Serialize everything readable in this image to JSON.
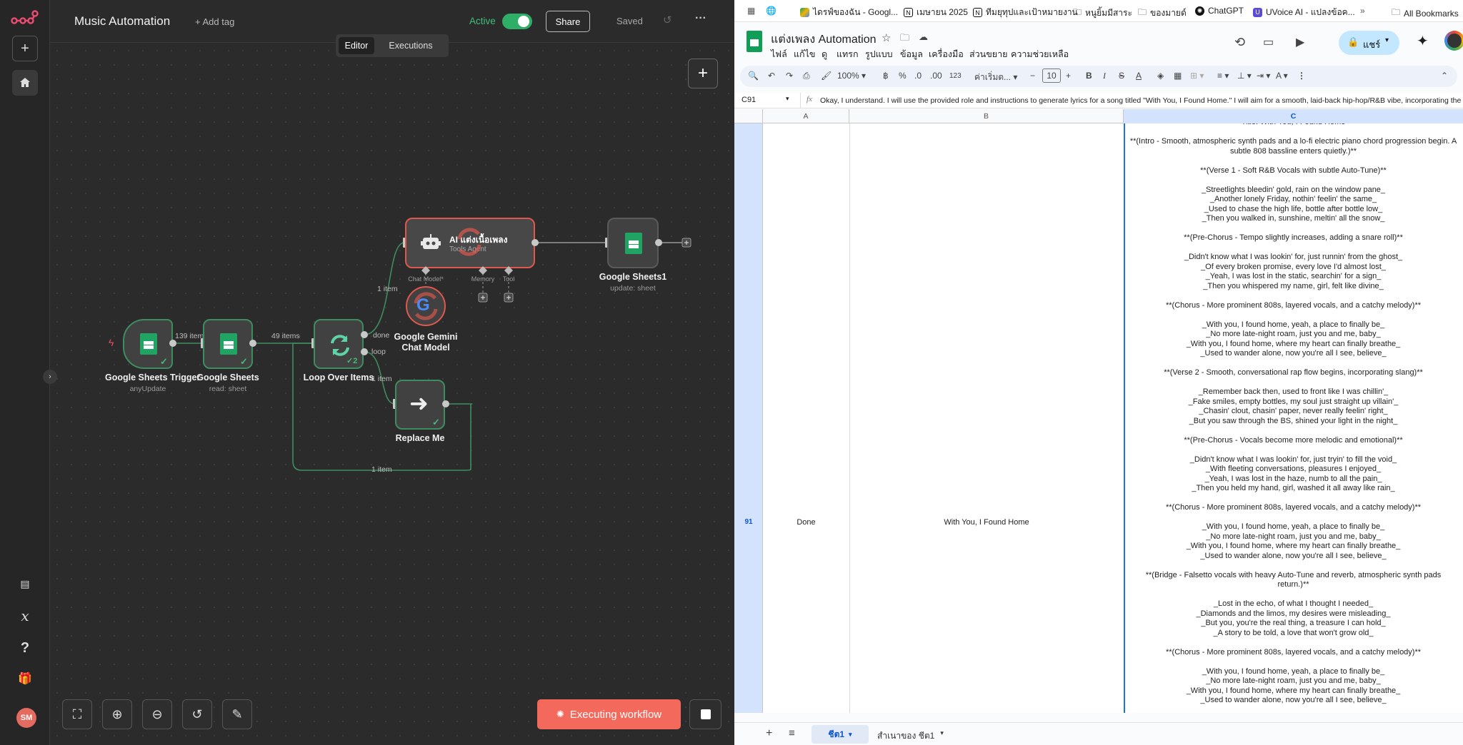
{
  "n8n": {
    "workflow_name": "Music Automation",
    "add_tag": "+ Add tag",
    "active_label": "Active",
    "share_label": "Share",
    "saved_label": "Saved",
    "tabs": {
      "editor": "Editor",
      "executions": "Executions"
    },
    "avatar_initials": "SM",
    "execute_label": "Executing workflow",
    "nodes": {
      "trigger": {
        "title": "Google Sheets Trigger",
        "sub": "anyUpdate"
      },
      "sheets": {
        "title": "Google Sheets",
        "sub": "read: sheet"
      },
      "loop": {
        "title": "Loop Over Items",
        "badge": "2"
      },
      "ai": {
        "title": "AI แต่งเนื้อเพลง",
        "sub": "Tools Agent",
        "slots": [
          "Chat Model*",
          "Memory",
          "Tool"
        ]
      },
      "gemini": {
        "title": "Google Gemini Chat Model"
      },
      "sheets1": {
        "title": "Google Sheets1",
        "sub": "update: sheet"
      },
      "replace": {
        "title": "Replace Me"
      }
    },
    "edges": {
      "e1": "139 items",
      "e2": "49 items",
      "e3": "1 item",
      "done": "done",
      "loop": "loop",
      "e4": "1 item",
      "e5": "1 item"
    }
  },
  "sheets": {
    "bookmarks": [
      "ไดรฟ์ของฉัน - Googl...",
      "เมษายน 2025",
      "ทีมยุทุปและเป้าหมายงาน",
      "หนูยิ้มมีสาระ",
      "ของมายด์",
      "ChatGPT",
      "UVoice AI - แปลงข้อค...",
      "All Bookmarks"
    ],
    "doc_title": "แต่งเพลง Automation",
    "menu": [
      "ไฟล์",
      "แก้ไข",
      "ดู",
      "แทรก",
      "รูปแบบ",
      "ข้อมูล",
      "เครื่องมือ",
      "ส่วนขยาย",
      "ความช่วยเหลือ"
    ],
    "share_label": "แชร์",
    "toolbar": {
      "zoom": "100%",
      "currency": "฿",
      "percent": "%",
      "dec1": ".0",
      "dec2": ".00",
      "num": "123",
      "font": "ค่าเริ่มต...",
      "size": "10"
    },
    "cell_ref": "C91",
    "formula": "Okay, I understand. I will use the provided role and instructions to generate lyrics for a song titled \"With You, I Found Home.\" I will aim for a smooth, laid-back hip-hop/R&B vibe, incorporating the",
    "columns": [
      "A",
      "B",
      "C"
    ],
    "row_number": "91",
    "cell_a": "Done",
    "cell_b": "With You, I Found Home",
    "lyrics": [
      "Title: With You, I Found Home",
      "",
      "**(Intro - Smooth, atmospheric synth pads and a lo-fi electric piano chord progression begin.  A",
      "subtle 808 bassline enters quietly.)**",
      "",
      "**(Verse 1 - Soft R&B Vocals with subtle Auto-Tune)**",
      "",
      "_Streetlights bleedin' gold, rain on the window pane_",
      "_Another lonely Friday, nothin' feelin' the same_",
      "_Used to chase the high life, bottle after bottle low_",
      "_Then you walked in, sunshine, meltin' all the snow_",
      "",
      "**(Pre-Chorus - Tempo slightly increases, adding a snare roll)**",
      "",
      "_Didn't know what I was lookin' for, just runnin' from the ghost_",
      "_Of every broken promise, every love I'd almost lost_",
      "_Yeah, I was lost in the static, searchin' for a sign_",
      "_Then you whispered my name, girl, felt like divine_",
      "",
      "**(Chorus - More prominent 808s, layered vocals, and a catchy melody)**",
      "",
      "_With you, I found home, yeah, a place to finally be_",
      "_No more late-night roam, just you and me, baby_",
      "_With you, I found home, where my heart can finally breathe_",
      "_Used to wander alone, now you're all I see, believe_",
      "",
      "**(Verse 2 -  Smooth, conversational rap flow begins, incorporating slang)**",
      "",
      "_Remember back then, used to front like I was chillin'_",
      "_Fake smiles, empty bottles, my soul just straight up villain'_",
      "_Chasin' clout, chasin' paper, never really feelin' right_",
      "_But you saw through the BS, shined your light in the night_",
      "",
      "**(Pre-Chorus - Vocals become more melodic and emotional)**",
      "",
      "_Didn't know what I was lookin' for, just tryin' to fill the void_",
      "_With fleeting conversations, pleasures I enjoyed_",
      "_Yeah, I was lost in the haze, numb to all the pain_",
      "_Then you held my hand, girl, washed it all away like rain_",
      "",
      "**(Chorus - More prominent 808s, layered vocals, and a catchy melody)**",
      "",
      "_With you, I found home, yeah, a place to finally be_",
      "_No more late-night roam, just you and me, baby_",
      "_With you, I found home, where my heart can finally breathe_",
      "_Used to wander alone, now you're all I see, believe_",
      "",
      "**(Bridge -  Falsetto vocals with heavy Auto-Tune and reverb, atmospheric synth pads",
      "return.)**",
      "",
      "_Lost in the echo, of what I thought I needed_",
      "_Diamonds and the limos, my desires were misleading_",
      "_But you, you're the real thing, a treasure I can hold_",
      "_A story to be told, a love that won't grow old_",
      "",
      "**(Chorus - More prominent 808s, layered vocals, and a catchy melody)**",
      "",
      "_With you, I found home, yeah, a place to finally be_",
      "_No more late-night roam, just you and me, baby_",
      "_With you, I found home, where my heart can finally breathe_",
      "_Used to wander alone, now you're all I see, believe_"
    ],
    "sheet_tabs": [
      "ชีต1",
      "สำเนาของ ชีต1"
    ]
  }
}
